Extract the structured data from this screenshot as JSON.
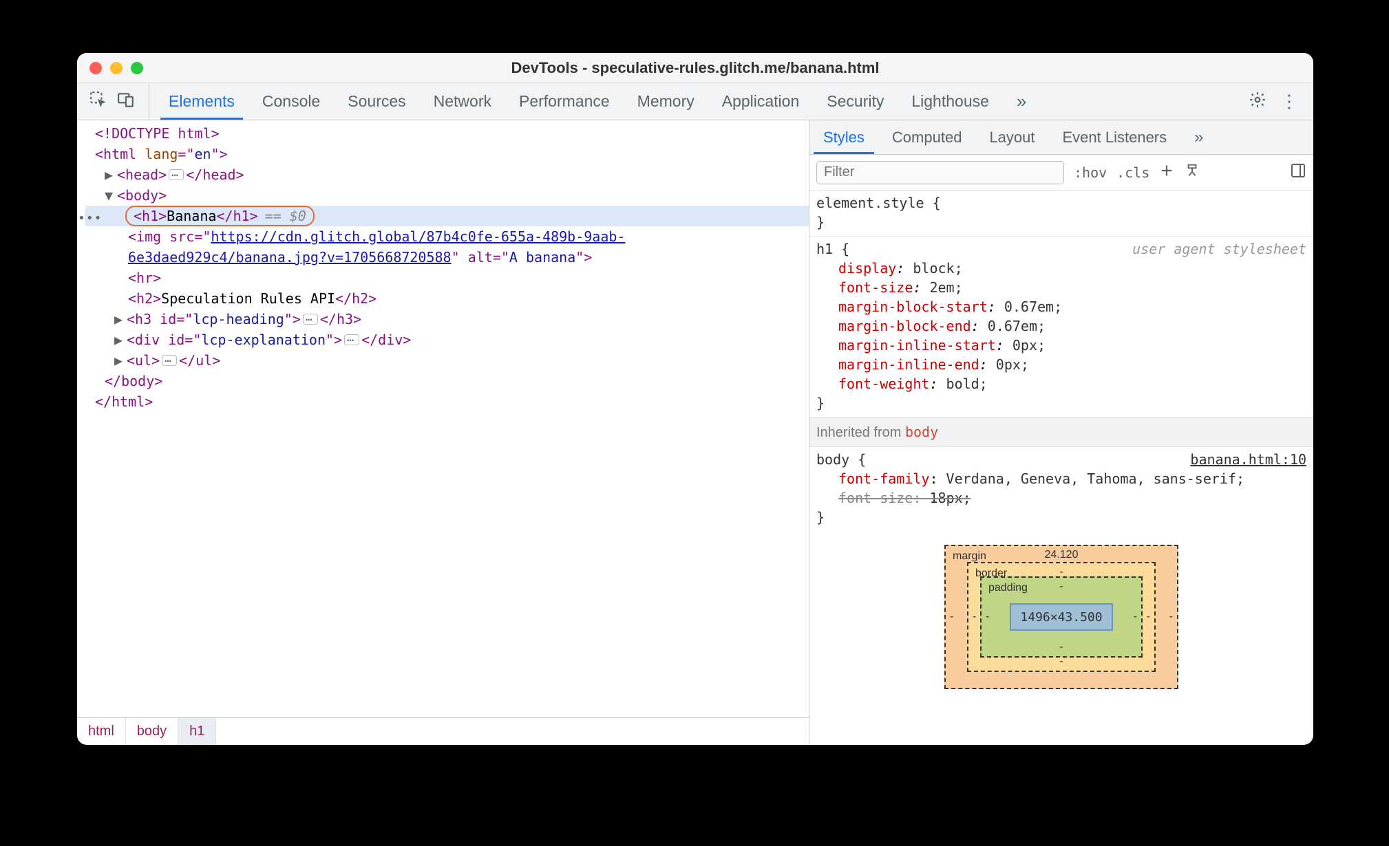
{
  "window": {
    "title": "DevTools - speculative-rules.glitch.me/banana.html"
  },
  "tabs": [
    "Elements",
    "Console",
    "Sources",
    "Network",
    "Performance",
    "Memory",
    "Application",
    "Security",
    "Lighthouse"
  ],
  "active_tab": "Elements",
  "overflow_glyph": "»",
  "dom": {
    "doctype": "<!DOCTYPE html>",
    "html_open": "<html lang=\"en\">",
    "head": {
      "open": "<head>",
      "close": "</head>"
    },
    "body_open": "<body>",
    "h1_tag_open": "<h1>",
    "h1_text": "Banana",
    "h1_tag_close": "</h1>",
    "h1_suffix": "== $0",
    "img_prefix": "<img src=\"",
    "img_src": "https://cdn.glitch.global/87b4c0fe-655a-489b-9aab-6e3daed929c4/banana.jpg?v=1705668720588",
    "img_mid": "\" alt=\"",
    "img_alt": "A banana",
    "img_suffix": "\">",
    "hr": "<hr>",
    "h2_open": "<h2>",
    "h2_text": "Speculation Rules API",
    "h2_close": "</h2>",
    "h3_open": "<h3 id=\"",
    "h3_id": "lcp-heading",
    "h3_mid": "\">",
    "h3_close": "</h3>",
    "div_open": "<div id=\"",
    "div_id": "lcp-explanation",
    "div_mid": "\">",
    "div_close": "</div>",
    "ul_open": "<ul>",
    "ul_close": "</ul>",
    "body_close": "</body>",
    "html_close": "</html>"
  },
  "breadcrumbs": [
    "html",
    "body",
    "h1"
  ],
  "right_tabs": [
    "Styles",
    "Computed",
    "Layout",
    "Event Listeners"
  ],
  "right_active": "Styles",
  "filter": {
    "placeholder": "Filter",
    "hov": ":hov",
    "cls": ".cls"
  },
  "rules": {
    "element_style_selector": "element.style",
    "h1_selector": "h1",
    "h1_origin": "user agent stylesheet",
    "h1_props": [
      {
        "p": "display",
        "v": "block;"
      },
      {
        "p": "font-size",
        "v": "2em;"
      },
      {
        "p": "margin-block-start",
        "v": "0.67em;"
      },
      {
        "p": "margin-block-end",
        "v": "0.67em;"
      },
      {
        "p": "margin-inline-start",
        "v": "0px;"
      },
      {
        "p": "margin-inline-end",
        "v": "0px;"
      },
      {
        "p": "font-weight",
        "v": "bold;"
      }
    ],
    "inherited_label": "Inherited from ",
    "inherited_from": "body",
    "body_selector": "body",
    "body_filelink": "banana.html:10",
    "body_props": [
      {
        "p": "font-family",
        "v": "Verdana, Geneva, Tahoma, sans-serif;",
        "struck": false
      },
      {
        "p": "font-size",
        "v": "18px;",
        "struck": true
      }
    ]
  },
  "boxmodel": {
    "margin_label": "margin",
    "border_label": "border",
    "padding_label": "padding",
    "margin_top": "24.120",
    "content": "1496×43.500",
    "dash": "-"
  }
}
